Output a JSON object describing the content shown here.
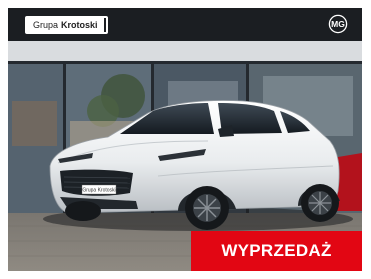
{
  "header": {
    "dealer_prefix": "Grupa",
    "dealer_name": "Krotoski",
    "brand_logo_text": "MG"
  },
  "car": {
    "plate_text": "Grupa Krotoski"
  },
  "cta": {
    "label": "WYPRZEDAŻ"
  },
  "colors": {
    "accent_red": "#e20613",
    "car_body": "#eef0f1",
    "topbar": "#1b1e22"
  }
}
